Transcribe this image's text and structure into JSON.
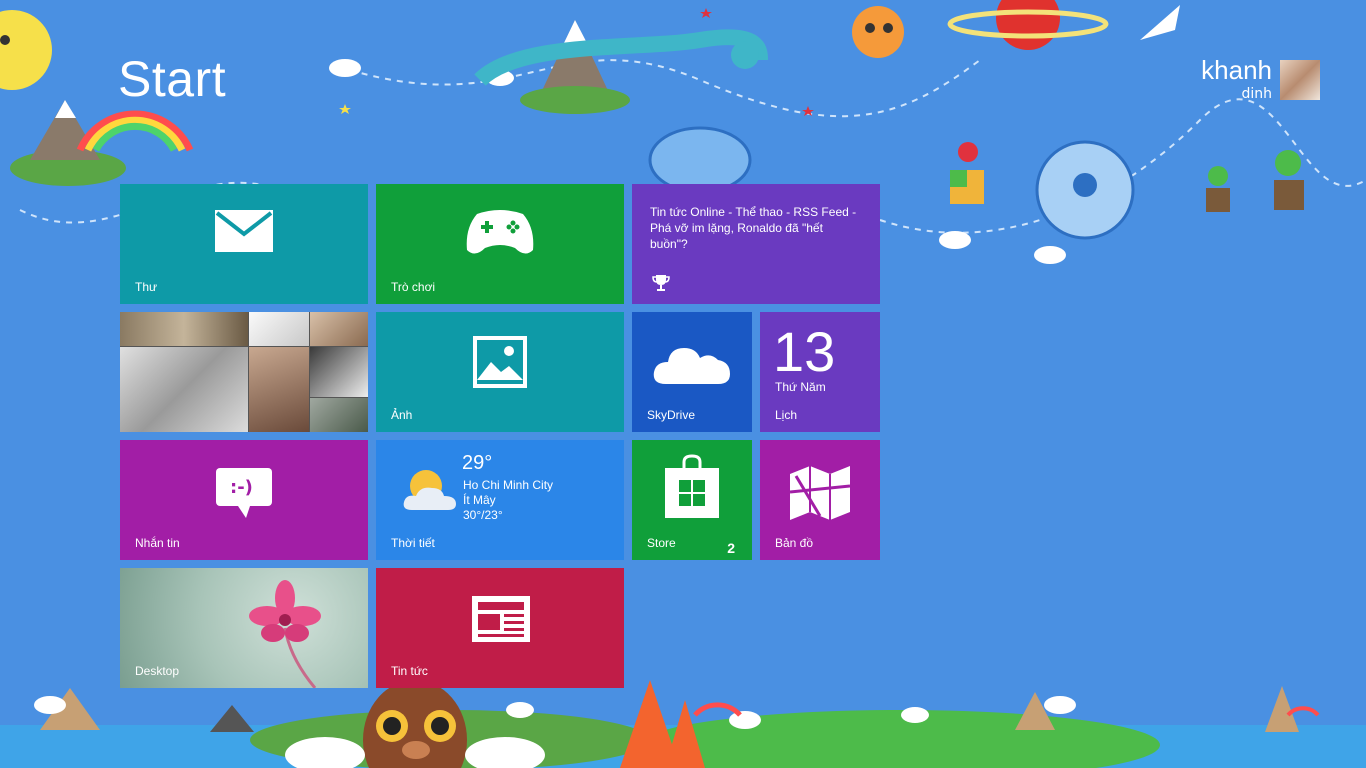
{
  "screen": {
    "title": "Start",
    "accent_color": "#4a90e2"
  },
  "user": {
    "name": "khanh",
    "subtitle": "dinh"
  },
  "tiles": {
    "mail": {
      "label": "Thư",
      "color": "#0e9aa7",
      "icon": "mail-icon"
    },
    "games": {
      "label": "Trò chơi",
      "color": "#109f3a",
      "icon": "xbox-controller-icon"
    },
    "news_feed": {
      "text": "Tin tức Online - Thể thao - RSS Feed - Phá vỡ im lặng, Ronaldo đã \"hết buồn\"?",
      "color": "#6a3ac0",
      "icon": "trophy-icon"
    },
    "people": {
      "color": "#555555",
      "icon": "photo-collage"
    },
    "photos": {
      "label": "Ảnh",
      "color": "#0e9aa7",
      "icon": "picture-icon"
    },
    "skydrive": {
      "label": "SkyDrive",
      "color": "#1a58c4",
      "icon": "cloud-icon"
    },
    "calendar": {
      "label": "Lịch",
      "number": "13",
      "day": "Thứ Năm",
      "color": "#6a3ac0"
    },
    "messaging": {
      "label": "Nhắn tin",
      "color": "#a21ea6",
      "icon": "chat-bubble-icon"
    },
    "weather": {
      "label": "Thời tiết",
      "temp": "29°",
      "city": "Ho Chi Minh City",
      "condition": "Ít Mây",
      "range": "30°/23°",
      "color": "#2b86e8",
      "icon": "partly-cloudy-icon"
    },
    "store": {
      "label": "Store",
      "badge": "2",
      "color": "#109f3a",
      "icon": "shopping-bag-icon"
    },
    "maps": {
      "label": "Bản đồ",
      "color": "#a21ea6",
      "icon": "map-icon"
    },
    "desktop": {
      "label": "Desktop",
      "color": "#9fc0b4",
      "icon": "flower-wallpaper"
    },
    "news": {
      "label": "Tin tức",
      "color": "#c01d48",
      "icon": "newspaper-icon"
    }
  }
}
